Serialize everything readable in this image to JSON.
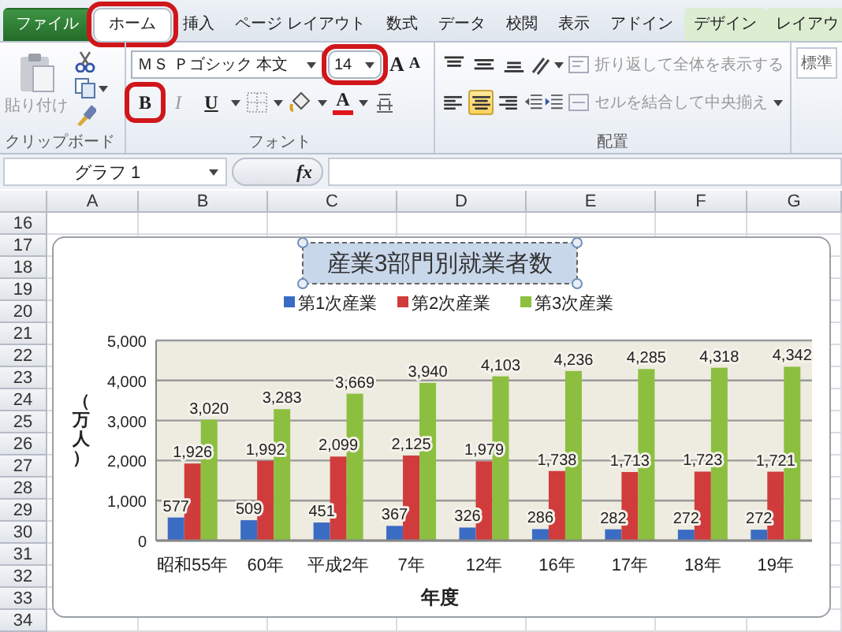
{
  "tabs": [
    {
      "label": "ファイル",
      "kind": "file",
      "selected": false,
      "annotated": false
    },
    {
      "label": "ホーム",
      "kind": "normal",
      "selected": true,
      "annotated": true
    },
    {
      "label": "挿入",
      "kind": "normal",
      "selected": false,
      "annotated": false
    },
    {
      "label": "ページ レイアウト",
      "kind": "normal",
      "selected": false,
      "annotated": false
    },
    {
      "label": "数式",
      "kind": "normal",
      "selected": false,
      "annotated": false
    },
    {
      "label": "データ",
      "kind": "normal",
      "selected": false,
      "annotated": false
    },
    {
      "label": "校閲",
      "kind": "normal",
      "selected": false,
      "annotated": false
    },
    {
      "label": "表示",
      "kind": "normal",
      "selected": false,
      "annotated": false
    },
    {
      "label": "アドイン",
      "kind": "normal",
      "selected": false,
      "annotated": false
    },
    {
      "label": "デザイン",
      "kind": "context",
      "selected": false,
      "annotated": false
    },
    {
      "label": "レイアウ",
      "kind": "context",
      "selected": false,
      "annotated": false
    }
  ],
  "ribbon": {
    "clipboard": {
      "paste_label": "貼り付け",
      "paste_disabled": true,
      "group_label": "クリップボード"
    },
    "font": {
      "font_name": "ＭＳ Ｐゴシック 本文",
      "font_size": "14",
      "size_annotated": true,
      "grow_label": "A",
      "shrink_label": "A",
      "format_buttons": [
        {
          "label": "B",
          "kind": "bold",
          "annotated": true
        },
        {
          "label": "I",
          "kind": "italic",
          "annotated": false
        },
        {
          "label": "U",
          "kind": "underline",
          "annotated": false
        }
      ],
      "color_label": "A",
      "group_label": "フォント"
    },
    "alignment": {
      "horizontal": [
        {
          "kind": "left",
          "selected": false
        },
        {
          "kind": "center",
          "selected": true
        },
        {
          "kind": "right",
          "selected": false
        }
      ],
      "wrap_text": {
        "label": "折り返して全体を表示する",
        "disabled": true
      },
      "merge": {
        "label": "セルを結合して中央揃え",
        "disabled": true
      },
      "group_label": "配置"
    },
    "number_format": "標準"
  },
  "formula_bar": {
    "name_box": "グラフ 1",
    "fx": "fx"
  },
  "columns": [
    "A",
    "B",
    "C",
    "D",
    "E",
    "F",
    "G"
  ],
  "rows": [
    "16",
    "17",
    "18",
    "19",
    "20",
    "21",
    "22",
    "23",
    "24",
    "25",
    "26",
    "27",
    "28",
    "29",
    "30",
    "31",
    "32",
    "33",
    "34"
  ],
  "chart": {
    "chart_data": {
      "type": "bar",
      "title": "産業3部門別就業者数",
      "xlabel": "年度",
      "ylabel": "（万人）",
      "legend": "top",
      "grid": true,
      "categories": [
        "昭和55年",
        "60年",
        "平成2年",
        "7年",
        "12年",
        "16年",
        "17年",
        "18年",
        "19年"
      ],
      "series": [
        {
          "name": "第1次産業",
          "color": "#3a6cc4",
          "values": [
            577,
            509,
            451,
            367,
            326,
            286,
            282,
            272,
            272
          ],
          "value_labels": [
            "577",
            "509",
            "451",
            "367",
            "326",
            "286",
            "282",
            "272",
            "272"
          ]
        },
        {
          "name": "第2次産業",
          "color": "#d03c3c",
          "values": [
            1926,
            1992,
            2099,
            2125,
            1979,
            1738,
            1713,
            1723,
            1721
          ],
          "value_labels": [
            "1,926",
            "1,992",
            "2,099",
            "2,125",
            "1,979",
            "1,738",
            "1,713",
            "1,723",
            "1,721"
          ]
        },
        {
          "name": "第3次産業",
          "color": "#8cbf3f",
          "values": [
            3020,
            3283,
            3669,
            3940,
            4103,
            4236,
            4285,
            4318,
            4342
          ],
          "value_labels": [
            "3,020",
            "3,283",
            "3,669",
            "3,940",
            "4,103",
            "4,236",
            "4,285",
            "4,318",
            "4,342"
          ]
        }
      ],
      "ylim": [
        0,
        5000
      ],
      "yticks": [
        {
          "value": 0,
          "label": "0"
        },
        {
          "value": 1000,
          "label": "1,000"
        },
        {
          "value": 2000,
          "label": "2,000"
        },
        {
          "value": 3000,
          "label": "3,000"
        },
        {
          "value": 4000,
          "label": "4,000"
        },
        {
          "value": 5000,
          "label": "5,000"
        }
      ]
    }
  }
}
